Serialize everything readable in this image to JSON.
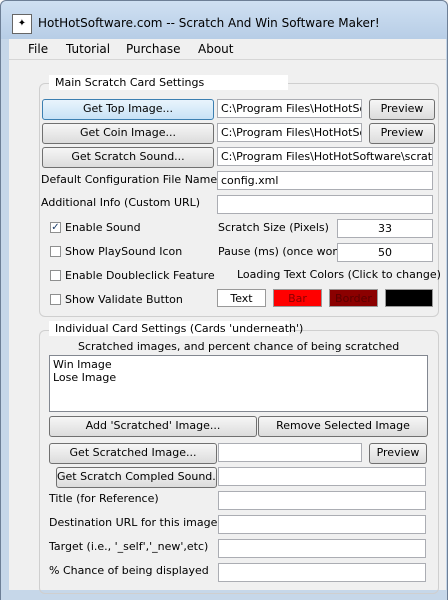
{
  "window": {
    "title": "HotHotSoftware.com -- Scratch And Win Software Maker!"
  },
  "menu": [
    {
      "label": "File"
    },
    {
      "label": "Tutorial"
    },
    {
      "label": "Purchase"
    },
    {
      "label": "About"
    }
  ],
  "main": {
    "group_label": "Main Scratch Card Settings",
    "top_image_btn": "Get Top Image...",
    "top_image_path": "C:\\Program Files\\HotHotSoftw",
    "top_image_preview": "Preview",
    "coin_image_btn": "Get Coin Image...",
    "coin_image_path": "C:\\Program Files\\HotHotSoftw",
    "coin_image_preview": "Preview",
    "scratch_sound_btn": "Get Scratch Sound...",
    "scratch_sound_path": "C:\\Program Files\\HotHotSoftware\\scratch_a",
    "config_label": "Default Configuration File Name",
    "config_value": "config.xml",
    "additional_label": "Additional Info (Custom URL)",
    "additional_value": "",
    "enable_sound": {
      "label": "Enable Sound",
      "checked": true
    },
    "show_playsound": {
      "label": "Show PlaySound Icon",
      "checked": false
    },
    "enable_doubleclick": {
      "label": "Enable Doubleclick Feature",
      "checked": false
    },
    "show_validate": {
      "label": "Show Validate Button",
      "checked": false
    },
    "scratch_size_label": "Scratch Size (Pixels)",
    "scratch_size_value": "33",
    "pause_label": "Pause (ms) (once won)",
    "pause_value": "50",
    "loading_colors_label": "Loading Text Colors (Click to change)",
    "colors": [
      {
        "label": "Text",
        "bg": "#ffffff",
        "fg": "#000000"
      },
      {
        "label": "Bar",
        "bg": "#ff0000",
        "fg": "#8b0000"
      },
      {
        "label": "Border",
        "bg": "#8b0000",
        "fg": "#5a0000"
      },
      {
        "label": "",
        "bg": "#000000",
        "fg": "#000000"
      }
    ]
  },
  "individual": {
    "group_label": "Individual Card Settings (Cards 'underneath')",
    "list_caption": "Scratched images, and percent chance of being scratched",
    "list_items": [
      "Win Image",
      "Lose Image"
    ],
    "add_btn": "Add 'Scratched' Image...",
    "remove_btn": "Remove Selected Image",
    "get_scratched_btn": "Get Scratched Image...",
    "scratched_path": "",
    "scratched_preview": "Preview",
    "get_sound_btn": "Get Scratch Compled Sound...",
    "sound_path": "",
    "title_label": "Title (for Reference)",
    "dest_label": "Destination URL for this image",
    "target_label": "Target (i.e., '_self','_new',etc)",
    "chance_label": "% Chance of being displayed"
  }
}
